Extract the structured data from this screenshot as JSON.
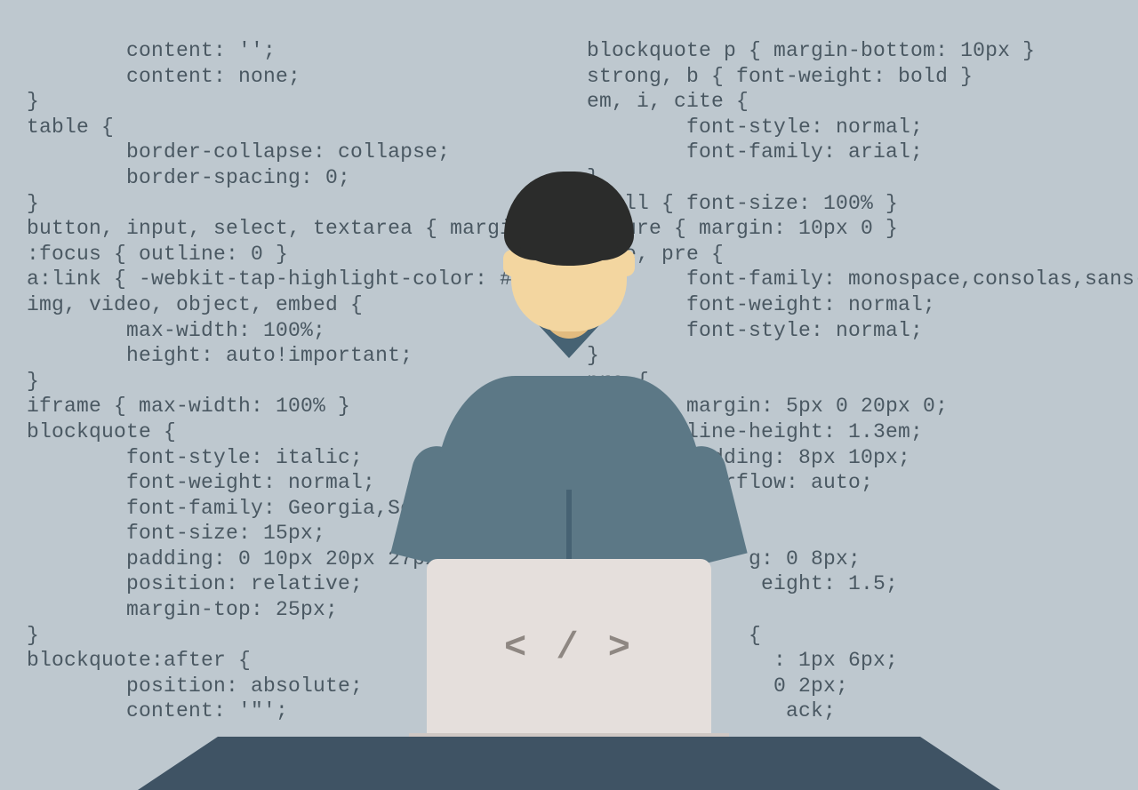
{
  "colors": {
    "background": "#bec8cf",
    "code_text": "#4a5862",
    "desk": "#3f5364",
    "laptop": "#e5dfdc",
    "laptop_base": "#cfc8c4",
    "shirt": "#5c7886",
    "shirt_dark": "#466273",
    "skin": "#f3d6a0",
    "hair": "#2b2c2b"
  },
  "laptop_symbol": "< / >",
  "code_left": "        content: '';\n        content: none;\n}\ntable {\n        border-collapse: collapse;\n        border-spacing: 0;\n}\nbutton, input, select, textarea { margin: 0 }\n:focus { outline: 0 }\na:link { -webkit-tap-highlight-color: #FF5E99 }\nimg, video, object, embed {\n        max-width: 100%;\n        height: auto!important;\n}\niframe { max-width: 100% }\nblockquote {\n        font-style: italic;\n        font-weight: normal;\n        font-family: Georgia,Serif;\n        font-size: 15px;\n        padding: 0 10px 20px 27px;\n        position: relative;\n        margin-top: 25px;\n}\nblockquote:after {\n        position: absolute;\n        content: '\"';",
  "code_right": "blockquote p { margin-bottom: 10px }\nstrong, b { font-weight: bold }\nem, i, cite {\n        font-style: normal;\n        font-family: arial;\n}\nsmall { font-size: 100% }\nfigure { margin: 10px 0 }\ncode, pre {\n        font-family: monospace,consolas,sans-serif;\n        font-weight: normal;\n        font-style: normal;\n}\npre {\n        margin: 5px 0 20px 0;\n        line-height: 1.3em;\n        padding: 8px 10px;\n        overflow: auto;\n}\n       {\n             g: 0 8px;\n              eight: 1.5;\n}\n             {\n               : 1px 6px;\n               0 2px;\n                ack;"
}
